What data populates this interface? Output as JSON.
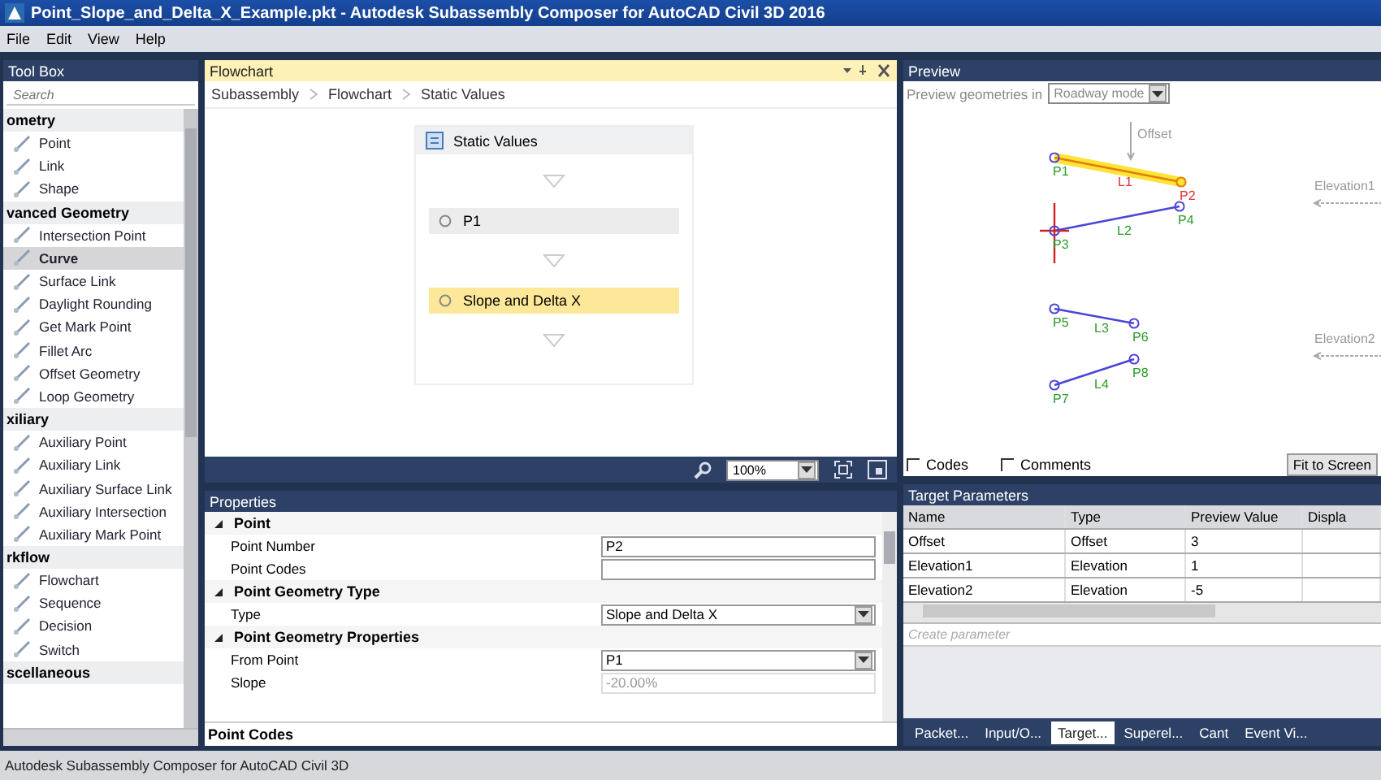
{
  "window": {
    "title": "Point_Slope_and_Delta_X_Example.pkt - Autodesk Subassembly Composer for AutoCAD Civil 3D 2016"
  },
  "menu": [
    "File",
    "Edit",
    "View",
    "Help"
  ],
  "toolbox": {
    "title": "Tool Box",
    "search": {
      "placeholder": "Search"
    },
    "sections": [
      {
        "title": "ometry",
        "items": [
          {
            "label": "Point",
            "selected": false
          },
          {
            "label": "Link",
            "selected": false
          },
          {
            "label": "Shape",
            "selected": false
          }
        ]
      },
      {
        "title": "vanced Geometry",
        "items": [
          {
            "label": "Intersection Point",
            "selected": false
          },
          {
            "label": "Curve",
            "selected": true
          },
          {
            "label": "Surface Link",
            "selected": false
          },
          {
            "label": "Daylight Rounding",
            "selected": false
          },
          {
            "label": "Get Mark Point",
            "selected": false
          },
          {
            "label": "Fillet Arc",
            "selected": false
          },
          {
            "label": "Offset Geometry",
            "selected": false
          },
          {
            "label": "Loop Geometry",
            "selected": false
          }
        ]
      },
      {
        "title": "xiliary",
        "items": [
          {
            "label": "Auxiliary Point",
            "selected": false
          },
          {
            "label": "Auxiliary Link",
            "selected": false
          },
          {
            "label": "Auxiliary Surface Link",
            "selected": false
          },
          {
            "label": "Auxiliary Intersection",
            "selected": false
          },
          {
            "label": "Auxiliary Mark Point",
            "selected": false
          }
        ]
      },
      {
        "title": "rkflow",
        "items": [
          {
            "label": "Flowchart",
            "selected": false
          },
          {
            "label": "Sequence",
            "selected": false
          },
          {
            "label": "Decision",
            "selected": false
          },
          {
            "label": "Switch",
            "selected": false
          }
        ]
      },
      {
        "title": "scellaneous"
      }
    ]
  },
  "flowchart": {
    "title": "Flowchart",
    "breadcrumb": [
      "Subassembly",
      "Flowchart",
      "Static Values"
    ],
    "header": "Static Values",
    "nodes": [
      {
        "label": "P1",
        "selected": false
      },
      {
        "label": "Slope and Delta X",
        "selected": true
      }
    ],
    "zoom": "100%"
  },
  "properties": {
    "title": "Properties",
    "rows": [
      {
        "kind": "category",
        "label": "Point"
      },
      {
        "kind": "field",
        "label": "Point Number",
        "value": "P2",
        "disabled": false
      },
      {
        "kind": "field",
        "label": "Point Codes",
        "value": "",
        "disabled": false
      },
      {
        "kind": "category",
        "label": "Point Geometry Type"
      },
      {
        "kind": "dropdown",
        "label": "Type",
        "value": "Slope and Delta X",
        "disabled": false
      },
      {
        "kind": "category",
        "label": "Point Geometry Properties"
      },
      {
        "kind": "dropdown",
        "label": "From Point",
        "value": "P1",
        "disabled": false
      },
      {
        "kind": "field",
        "label": "Slope",
        "value": "-20.00%",
        "disabled": true
      }
    ],
    "description": "Point Codes"
  },
  "preview": {
    "title": "Preview",
    "mode_label": "Preview geometries in",
    "mode": "Roadway mode",
    "points": [
      {
        "label": "P1",
        "selected": false
      },
      {
        "label": "P2",
        "selected": true
      },
      {
        "label": "P3",
        "selected": false
      },
      {
        "label": "P4",
        "selected": false
      },
      {
        "label": "P5",
        "selected": false
      },
      {
        "label": "P6",
        "selected": false
      },
      {
        "label": "P7",
        "selected": false
      },
      {
        "label": "P8",
        "selected": false
      }
    ],
    "links": [
      {
        "label": "L1",
        "selected": true
      },
      {
        "label": "L2",
        "selected": false
      },
      {
        "label": "L3",
        "selected": false
      },
      {
        "label": "L4",
        "selected": false
      }
    ],
    "targets": [
      {
        "label": "Offset",
        "kind": "offset"
      },
      {
        "label": "Elevation1",
        "kind": "elevation"
      },
      {
        "label": "Elevation2",
        "kind": "elevation"
      }
    ],
    "checkboxes": [
      {
        "label": "Codes",
        "checked": false
      },
      {
        "label": "Comments",
        "checked": false
      }
    ],
    "fit_button": "Fit to Screen"
  },
  "target_parameters": {
    "title": "Target Parameters",
    "columns": [
      "Name",
      "Type",
      "Preview Value",
      "Displa"
    ],
    "rows": [
      [
        "Offset",
        "Offset",
        "3",
        ""
      ],
      [
        "Elevation1",
        "Elevation",
        "1",
        ""
      ],
      [
        "Elevation2",
        "Elevation",
        "-5",
        ""
      ]
    ],
    "create_placeholder": "Create parameter"
  },
  "bottom_tabs": [
    {
      "label": "Packet...",
      "selected": false
    },
    {
      "label": "Input/O...",
      "selected": false
    },
    {
      "label": "Target...",
      "selected": true
    },
    {
      "label": "Superel...",
      "selected": false
    },
    {
      "label": "Cant",
      "selected": false
    },
    {
      "label": "Event Vi...",
      "selected": false
    }
  ],
  "status_bar": "Autodesk Subassembly Composer for AutoCAD Civil 3D"
}
